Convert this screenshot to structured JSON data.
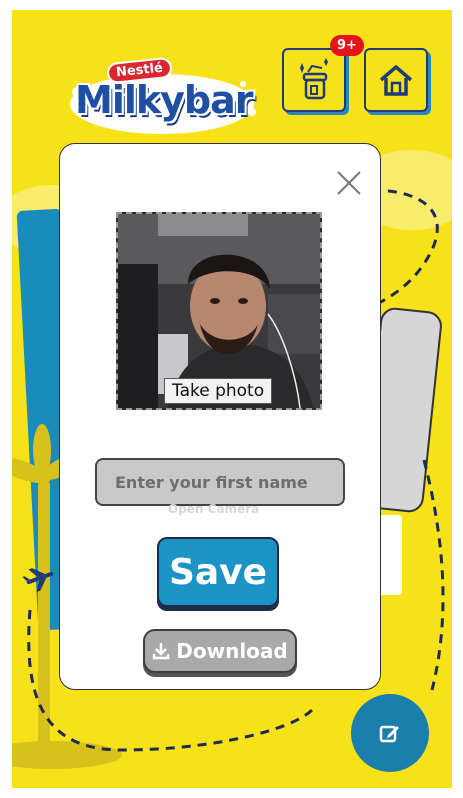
{
  "header": {
    "logo_brand": "Nestlé",
    "logo_text": "Milkybar",
    "rewards_icon": "rewards-jar-icon",
    "notification_count": "9+",
    "home_icon": "home-icon"
  },
  "modal": {
    "close_icon": "close-icon",
    "take_photo_label": "Take photo",
    "name_placeholder": "Enter your first name",
    "open_camera_label": "Open Camera",
    "save_label": "Save",
    "download_label": "Download",
    "download_icon": "download-icon"
  },
  "fab": {
    "icon": "edit-icon"
  },
  "colors": {
    "background": "#f7e21a",
    "accent_blue": "#1c93c4",
    "brand_blue": "#1e4fa3",
    "badge_red": "#e5141c",
    "path_navy": "#1e2a55"
  }
}
